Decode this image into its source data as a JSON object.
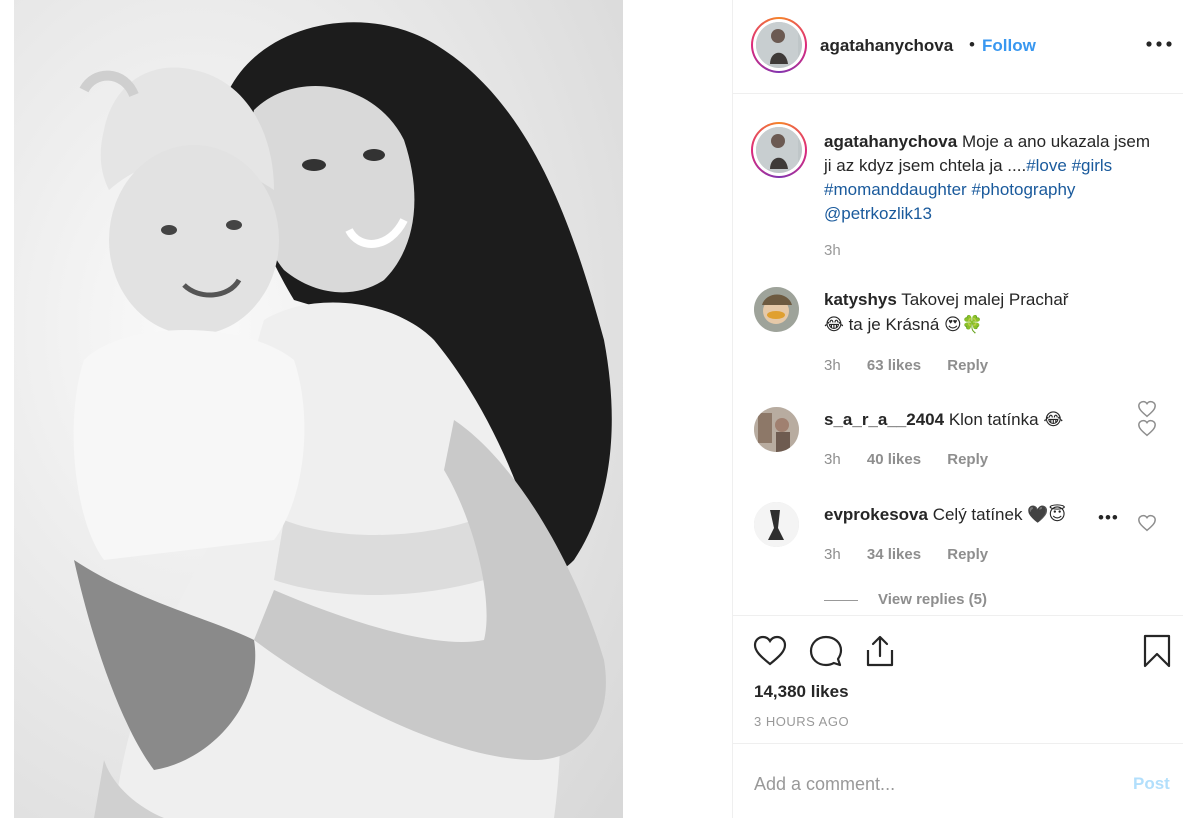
{
  "post": {
    "image_alt": "Black and white photo of a smiling woman with long dark hair holding a smiling toddler girl"
  },
  "header": {
    "username": "agatahanychova",
    "dot": "•",
    "follow_label": "Follow",
    "more_icon": "more-horizontal-icon"
  },
  "caption": {
    "username": "agatahanychova",
    "text": "Moje a ano ukazala jsem ji az kdyz jsem chtela ja ....",
    "hashtags": [
      "#love",
      "#girls",
      "#momanddaughter",
      "#photography"
    ],
    "mention": "@petrkozlik13",
    "time": "3h"
  },
  "comments": [
    {
      "username": "katyshys",
      "text_line1": "Takovej malej Prachař",
      "text_line2": "😂 ta je Krásná 😍🍀",
      "time": "3h",
      "likes": "63 likes",
      "reply": "Reply"
    },
    {
      "username": "s_a_r_a__2404",
      "text": "Klon tatínka 😂",
      "time": "3h",
      "likes": "40 likes",
      "reply": "Reply"
    },
    {
      "username": "evprokesova",
      "text": "Celý tatínek 🖤😇",
      "time": "3h",
      "likes": "34 likes",
      "reply": "Reply",
      "more": "•••"
    }
  ],
  "view_replies": "View replies (5)",
  "actions": {
    "like_icon": "heart-icon",
    "comment_icon": "comment-icon",
    "share_icon": "share-icon",
    "save_icon": "bookmark-icon",
    "likes_count": "14,380 likes",
    "post_time": "3 HOURS AGO"
  },
  "add_comment": {
    "placeholder": "Add a comment...",
    "post_label": "Post"
  },
  "colors": {
    "accent": "#3897f0",
    "link": "#1a5a9c",
    "post_disabled": "#b2dffc",
    "muted": "#8e8e8e"
  }
}
